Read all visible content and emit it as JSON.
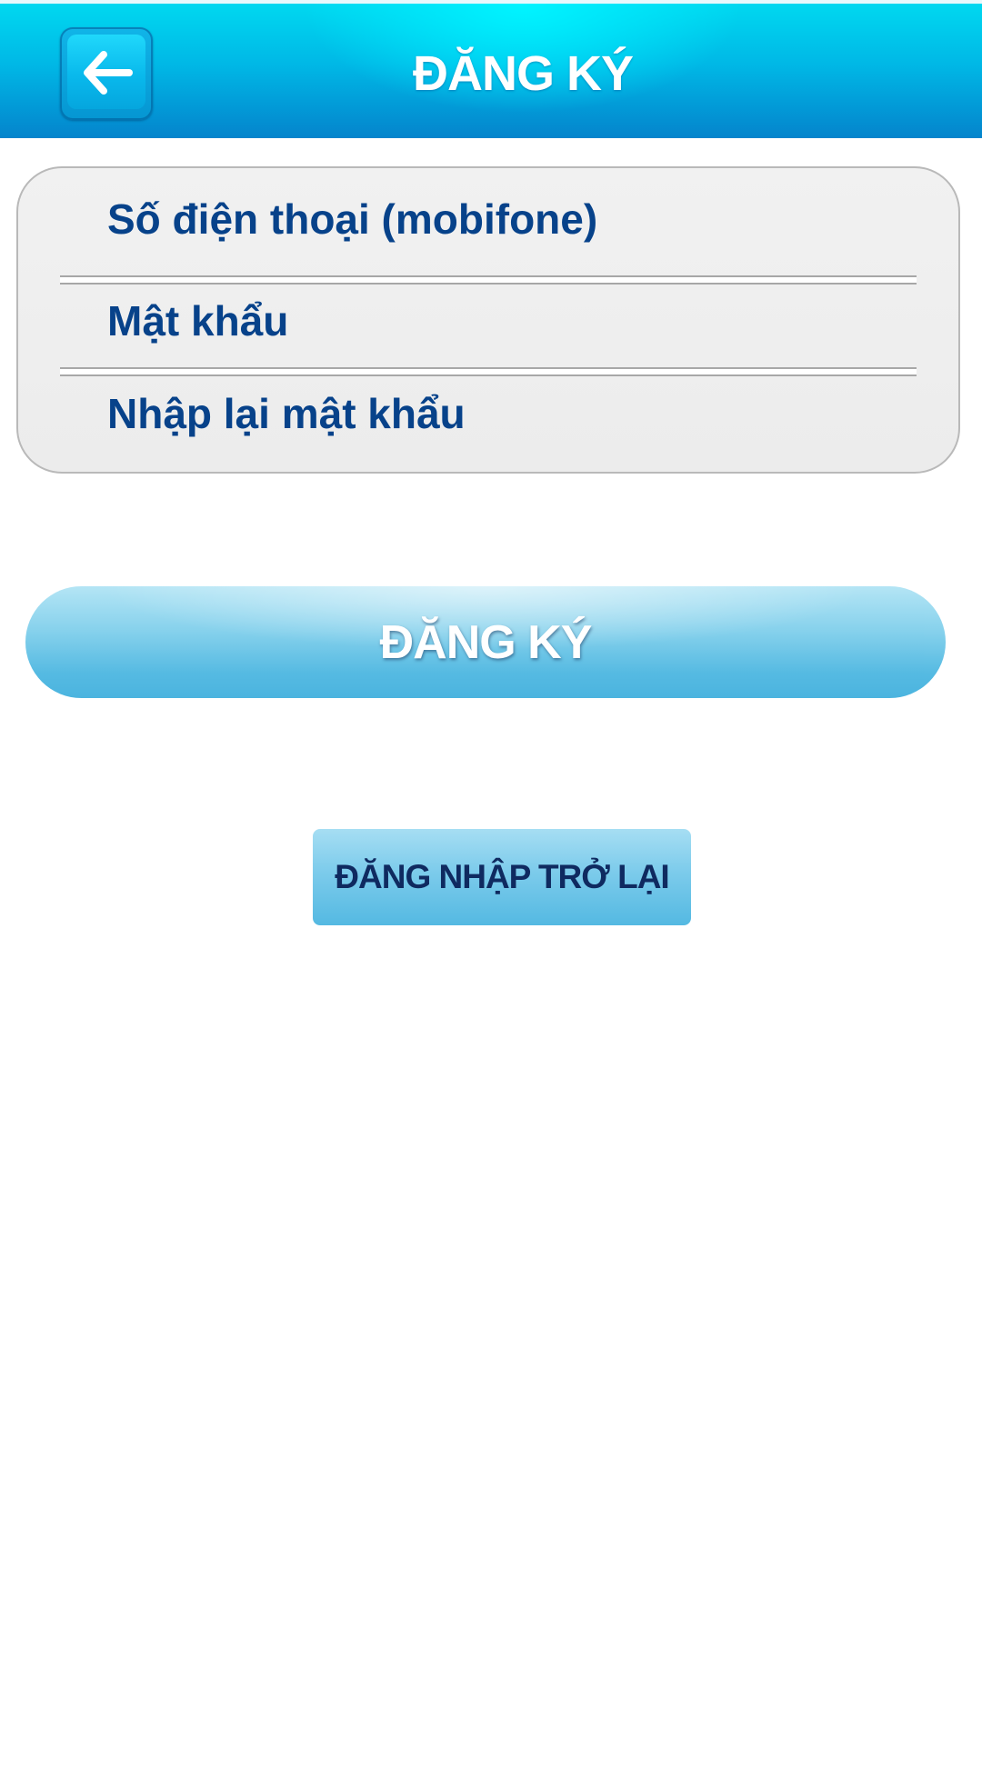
{
  "header": {
    "title": "ĐĂNG KÝ",
    "back_icon": "arrow-left-icon"
  },
  "form": {
    "phone_placeholder": "Số điện thoại (mobifone)",
    "password_placeholder": "Mật khẩu",
    "confirm_password_placeholder": "Nhập lại mật khẩu"
  },
  "actions": {
    "register_label": "ĐĂNG KÝ",
    "login_back_label": "ĐĂNG NHẬP TRỞ LẠI"
  },
  "colors": {
    "header_cyan": "#00d8f0",
    "header_blue": "#0484cc",
    "field_text": "#07428a",
    "button_blue": "#55bae2",
    "login_back_text": "#0f2a60"
  }
}
